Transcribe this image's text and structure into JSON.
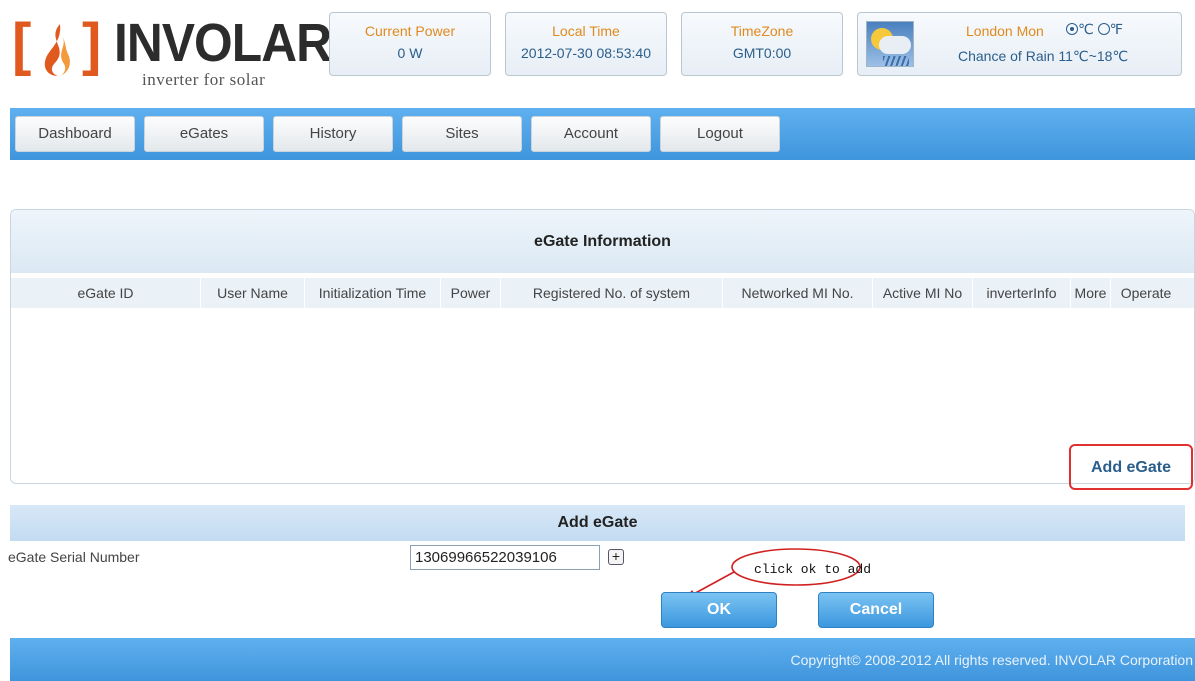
{
  "header": {
    "logo": {
      "brand": "INVOLAR",
      "tagline": "inverter for solar"
    },
    "current_power": {
      "label": "Current Power",
      "value": "0 W"
    },
    "local_time": {
      "label": "Local Time",
      "value": "2012-07-30 08:53:40"
    },
    "timezone": {
      "label": "TimeZone",
      "value": "GMT0:00"
    },
    "weather": {
      "location": "London Mon",
      "unit_c": "℃",
      "unit_f": "℉",
      "selected_unit": "C",
      "forecast": "Chance of Rain 11℃~18℃",
      "icon": "rain-cloud-sun-icon"
    }
  },
  "nav": {
    "tabs": [
      {
        "label": "Dashboard"
      },
      {
        "label": "eGates"
      },
      {
        "label": "History"
      },
      {
        "label": "Sites"
      },
      {
        "label": "Account"
      },
      {
        "label": "Logout"
      }
    ]
  },
  "egate_info": {
    "title": "eGate Information",
    "columns": [
      "eGate ID",
      "User Name",
      "Initialization Time",
      "Power",
      "Registered No. of system",
      "Networked MI No.",
      "Active MI No",
      "inverterInfo",
      "More",
      "Operate"
    ],
    "rows": [],
    "add_link": "Add eGate"
  },
  "add_egate": {
    "title": "Add eGate",
    "serial_label": "eGate Serial Number",
    "serial_value": "13069966522039106",
    "plus_label": "+",
    "annotation": "click ok to add",
    "ok_label": "OK",
    "cancel_label": "Cancel"
  },
  "footer": {
    "copyright": "Copyright© 2008-2012 All rights reserved. INVOLAR Corporation"
  },
  "colors": {
    "accent": "#e08a1e",
    "link": "#2a5e8c",
    "nav_blue": "#4aa2e5",
    "highlight": "#e03030"
  }
}
